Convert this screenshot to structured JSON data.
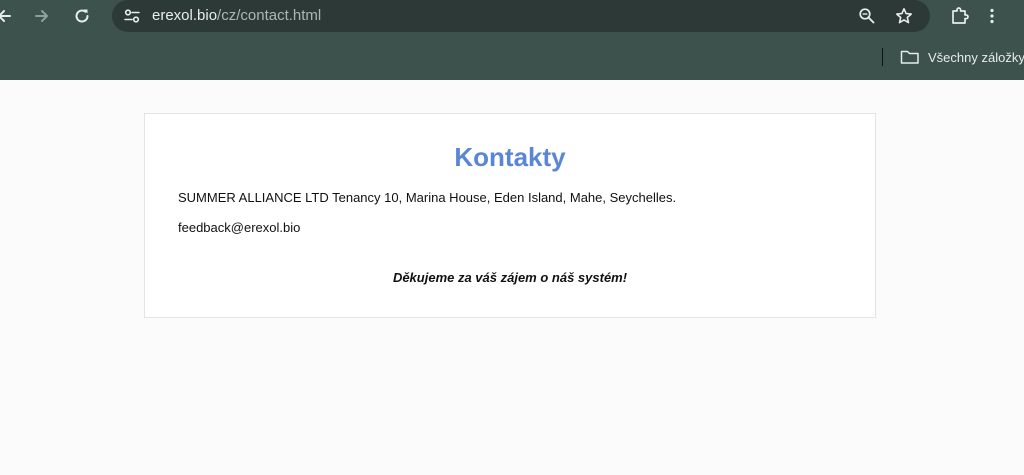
{
  "browser": {
    "url_host": "erexol.bio",
    "url_path": "/cz/contact.html",
    "bookmarks_folder_label": "Všechny záložky"
  },
  "icons": {
    "back": "back-arrow-icon",
    "forward": "forward-arrow-icon",
    "reload": "reload-icon",
    "site_info": "tune-icon",
    "zoom": "zoom-icon",
    "bookmark": "star-icon",
    "extensions": "puzzle-icon",
    "menu": "kebab-menu-icon",
    "folder": "folder-icon"
  },
  "colors": {
    "chrome_bg": "#3d524d",
    "omnibox_bg": "#2c3936",
    "heading": "#5a86d6"
  },
  "page": {
    "title": "Kontakty",
    "address": "SUMMER ALLIANCE LTD Tenancy 10, Marina House, Eden Island, Mahe, Seychelles.",
    "email": "feedback@erexol.bio",
    "thanks": "Děkujeme za váš zájem o náš systém!"
  }
}
